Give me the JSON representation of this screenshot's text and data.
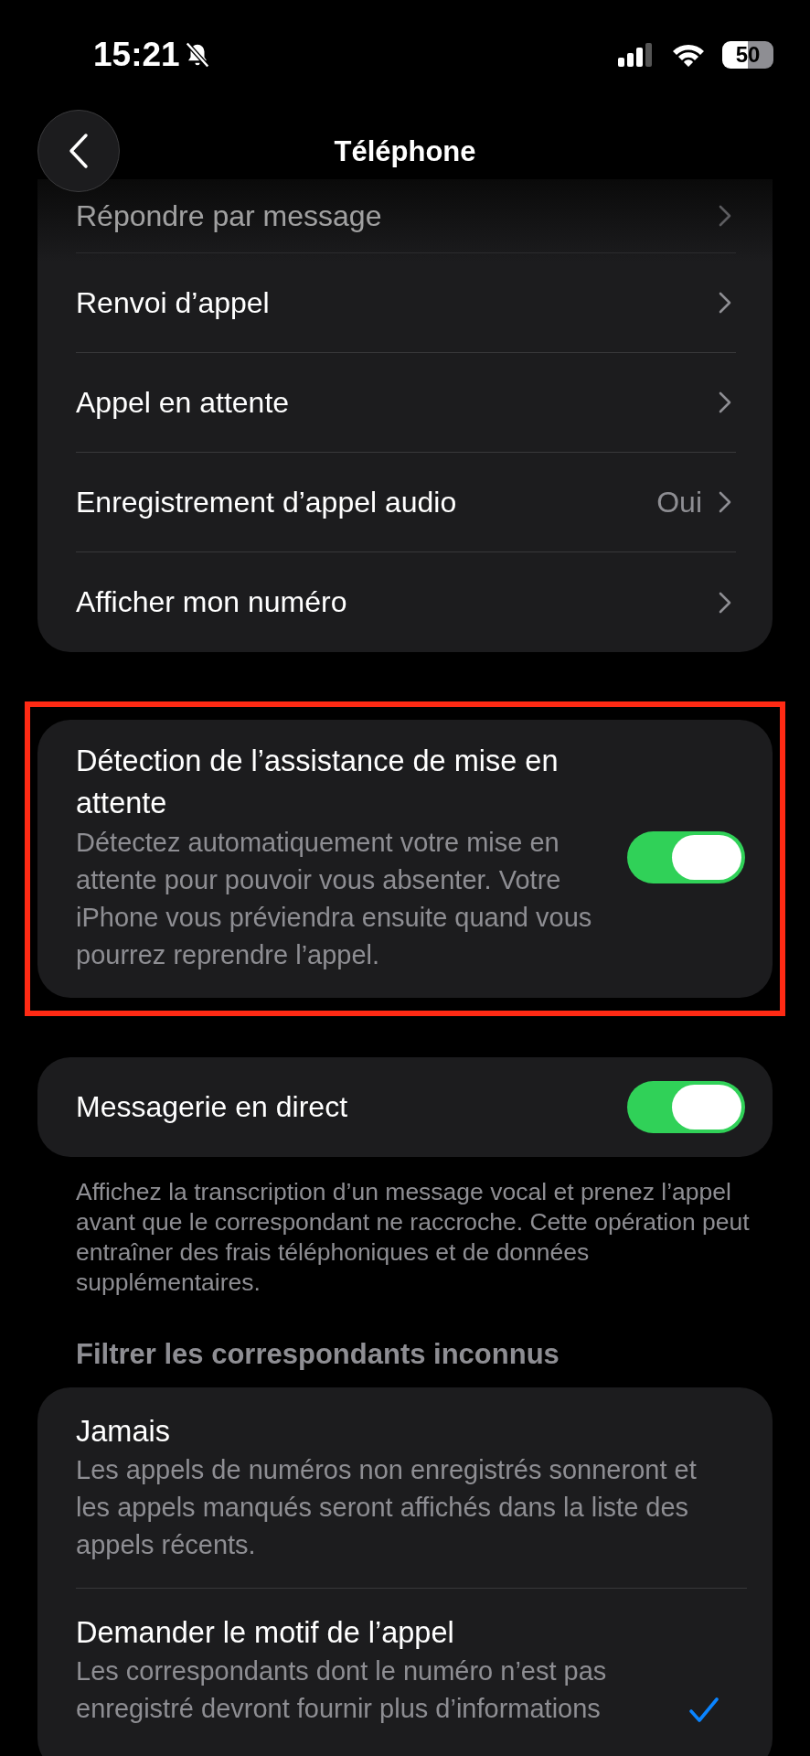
{
  "status_bar": {
    "time": "15:21",
    "battery": "50"
  },
  "nav": {
    "title": "Téléphone"
  },
  "call_group": {
    "rows": [
      {
        "label": "Répondre par message"
      },
      {
        "label": "Renvoi d’appel"
      },
      {
        "label": "Appel en attente"
      },
      {
        "label": "Enregistrement d’appel audio",
        "value": "Oui"
      },
      {
        "label": "Afficher mon numéro"
      }
    ]
  },
  "hold_assist": {
    "title": "Détection de l’assistance de mise en attente",
    "description": "Détectez automatiquement votre mise en attente pour pouvoir vous absenter. Votre iPhone vous préviendra ensuite quand vous pourrez reprendre l’appel.",
    "on": true,
    "highlighted": true
  },
  "live_voicemail": {
    "label": "Messagerie en direct",
    "on": true,
    "footnote": "Affichez la transcription d’un message vocal et prenez l’appel avant que le correspondant ne raccroche. Cette opération peut entraîner des frais téléphoniques et de données supplémentaires."
  },
  "filter_unknown": {
    "header": "Filtrer les correspondants inconnus",
    "options": [
      {
        "title": "Jamais",
        "description": "Les appels de numéros non enregistrés sonneront et les appels manqués seront affichés dans la liste des appels récents.",
        "selected": false
      },
      {
        "title": "Demander le motif de l’appel",
        "description": "Les correspondants dont le numéro n’est pas enregistré devront fournir plus d’informations",
        "selected": true
      }
    ]
  }
}
